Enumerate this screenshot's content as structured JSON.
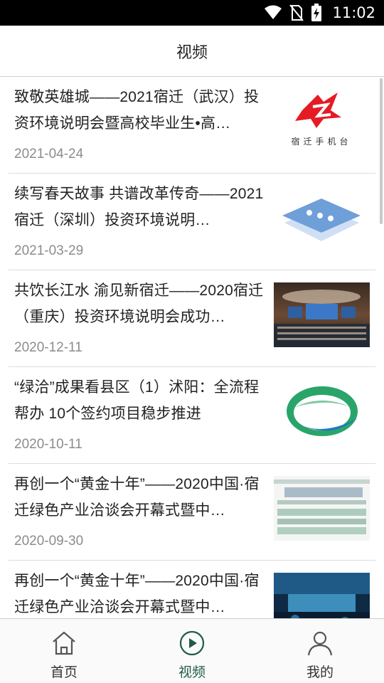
{
  "status_bar": {
    "time": "11:02",
    "icons": [
      "wifi-icon",
      "no-sim-icon",
      "battery-charging-icon"
    ]
  },
  "header": {
    "title": "视频"
  },
  "news": [
    {
      "title": "致敬英雄城——2021宿迁（武汉）投资环境说明会暨高校毕业生•高…",
      "date": "2021-04-24",
      "thumb": "宿迁手机台",
      "thumb_type": "logo"
    },
    {
      "title": "续写春天故事 共谱改革传奇——2021宿迁（深圳）投资环境说明…",
      "date": "2021-03-29",
      "thumb": "placeholder-icon",
      "thumb_type": "placeholder"
    },
    {
      "title": "共饮长江水 渝见新宿迁——2020宿迁（重庆）投资环境说明会成功…",
      "date": "2020-12-11",
      "thumb": "conference-hall-photo",
      "thumb_type": "photo"
    },
    {
      "title": "“绿洽”成果看县区（1）沭阳：全流程帮办 10个签约项目稳步推进",
      "date": "2020-10-11",
      "thumb": "green-logo",
      "thumb_type": "logo"
    },
    {
      "title": "再创一个“黄金十年”——2020中国·宿迁绿色产业洽谈会开幕式暨中…",
      "date": "2020-09-30",
      "thumb": "blurred-screenshot",
      "thumb_type": "photo"
    },
    {
      "title": "再创一个“黄金十年”——2020中国·宿迁绿色产业洽谈会开幕式暨中…",
      "date": "",
      "thumb": "stage-photo",
      "thumb_type": "photo"
    }
  ],
  "bottom_nav": [
    {
      "label": "首页",
      "icon": "home-icon",
      "active": false
    },
    {
      "label": "视频",
      "icon": "play-circle-icon",
      "active": true
    },
    {
      "label": "我的",
      "icon": "user-icon",
      "active": false
    }
  ],
  "colors": {
    "accent": "#1f5b46",
    "date_gray": "#8c8c8c",
    "status_bar": "#000000"
  }
}
